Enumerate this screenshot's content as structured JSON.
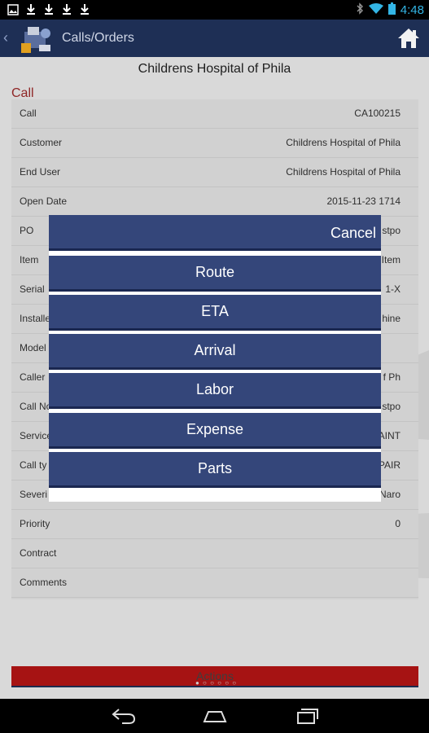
{
  "status_bar": {
    "time": "4:48",
    "left_icons": [
      "gallery-icon",
      "download-icon",
      "download-icon",
      "download-icon",
      "download-icon"
    ]
  },
  "header": {
    "title": "Calls/Orders"
  },
  "page": {
    "title": "Childrens Hospital of Phila",
    "section_label": "Call"
  },
  "rows": [
    {
      "label": "Call",
      "value": "CA100215"
    },
    {
      "label": "Customer",
      "value": "Childrens Hospital of Phila"
    },
    {
      "label": "End User",
      "value": "Childrens Hospital of Phila"
    },
    {
      "label": "Open Date",
      "value": "2015-11-23 1714"
    },
    {
      "label": "PO",
      "value": "stpo"
    },
    {
      "label": "Item",
      "value": "Item"
    },
    {
      "label": "Serial",
      "value": "1-X"
    },
    {
      "label": "Installe",
      "value": "hine"
    },
    {
      "label": "Model",
      "value": ""
    },
    {
      "label": "Caller",
      "value": "f Ph"
    },
    {
      "label": "Call No",
      "value": "stpo"
    },
    {
      "label": "Service",
      "value": "AINT"
    },
    {
      "label": "Call ty",
      "value": "PAIR"
    },
    {
      "label": "Severi",
      "value": "Naro"
    },
    {
      "label": "Priority",
      "value": "0"
    },
    {
      "label": "Contract",
      "value": ""
    },
    {
      "label": "Comments",
      "value": ""
    }
  ],
  "actions_label": "Actions",
  "dialog": {
    "cancel_label": "Cancel",
    "options": [
      "Route",
      "ETA",
      "Arrival",
      "Labor",
      "Expense",
      "Parts"
    ]
  },
  "colors": {
    "header_bg": "#1e2f55",
    "dialog_button": "#34467a",
    "section_label": "#9c2a2a",
    "actions_bar": "#b51515"
  }
}
